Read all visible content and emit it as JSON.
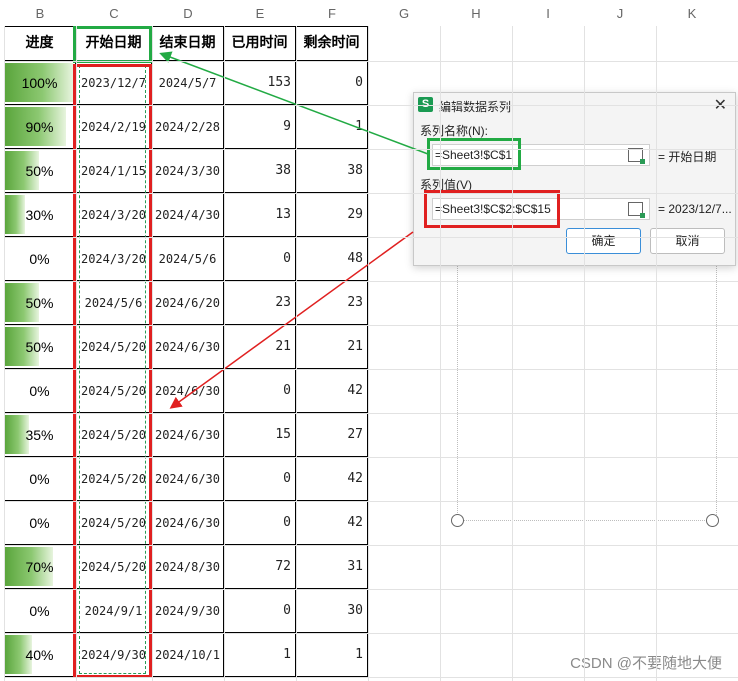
{
  "column_letters": [
    "B",
    "C",
    "D",
    "E",
    "F",
    "G",
    "H",
    "I",
    "J",
    "K"
  ],
  "table": {
    "headers": [
      "进度",
      "开始日期",
      "结束日期",
      "已用时间",
      "剩余时间"
    ],
    "rows": [
      {
        "progress": "100%",
        "progress_value": 1.0,
        "start": "2023/12/7",
        "end": "2024/5/7",
        "used": "153",
        "remaining": "0"
      },
      {
        "progress": "90%",
        "progress_value": 0.9,
        "start": "2024/2/19",
        "end": "2024/2/28",
        "used": "9",
        "remaining": "1"
      },
      {
        "progress": "50%",
        "progress_value": 0.5,
        "start": "2024/1/15",
        "end": "2024/3/30",
        "used": "38",
        "remaining": "38"
      },
      {
        "progress": "30%",
        "progress_value": 0.3,
        "start": "2024/3/20",
        "end": "2024/4/30",
        "used": "13",
        "remaining": "29"
      },
      {
        "progress": "0%",
        "progress_value": 0.0,
        "start": "2024/3/20",
        "end": "2024/5/6",
        "used": "0",
        "remaining": "48"
      },
      {
        "progress": "50%",
        "progress_value": 0.5,
        "start": "2024/5/6",
        "end": "2024/6/20",
        "used": "23",
        "remaining": "23"
      },
      {
        "progress": "50%",
        "progress_value": 0.5,
        "start": "2024/5/20",
        "end": "2024/6/30",
        "used": "21",
        "remaining": "21"
      },
      {
        "progress": "0%",
        "progress_value": 0.0,
        "start": "2024/5/20",
        "end": "2024/6/30",
        "used": "0",
        "remaining": "42"
      },
      {
        "progress": "35%",
        "progress_value": 0.35,
        "start": "2024/5/20",
        "end": "2024/6/30",
        "used": "15",
        "remaining": "27"
      },
      {
        "progress": "0%",
        "progress_value": 0.0,
        "start": "2024/5/20",
        "end": "2024/6/30",
        "used": "0",
        "remaining": "42"
      },
      {
        "progress": "0%",
        "progress_value": 0.0,
        "start": "2024/5/20",
        "end": "2024/6/30",
        "used": "0",
        "remaining": "42"
      },
      {
        "progress": "70%",
        "progress_value": 0.7,
        "start": "2024/5/20",
        "end": "2024/8/30",
        "used": "72",
        "remaining": "31"
      },
      {
        "progress": "0%",
        "progress_value": 0.0,
        "start": "2024/9/1",
        "end": "2024/9/30",
        "used": "0",
        "remaining": "30"
      },
      {
        "progress": "40%",
        "progress_value": 0.4,
        "start": "2024/9/30",
        "end": "2024/10/1",
        "used": "1",
        "remaining": "1"
      }
    ]
  },
  "dialog": {
    "app_icon": "S",
    "title": "编辑数据系列",
    "close": "✕",
    "name_label": "系列名称(N):",
    "name_value": "=Sheet3!$C$1",
    "name_result": "= 开始日期",
    "values_label": "系列值(V)",
    "values_value": "=Sheet3!$C$2:$C$15",
    "values_result": "= 2023/12/7...",
    "ok": "确定",
    "cancel": "取消"
  },
  "colors": {
    "green_highlight": "#22aa44",
    "red_highlight": "#e02020",
    "bar_green": "#5aa53c"
  },
  "watermark": "CSDN @不要随地大便"
}
